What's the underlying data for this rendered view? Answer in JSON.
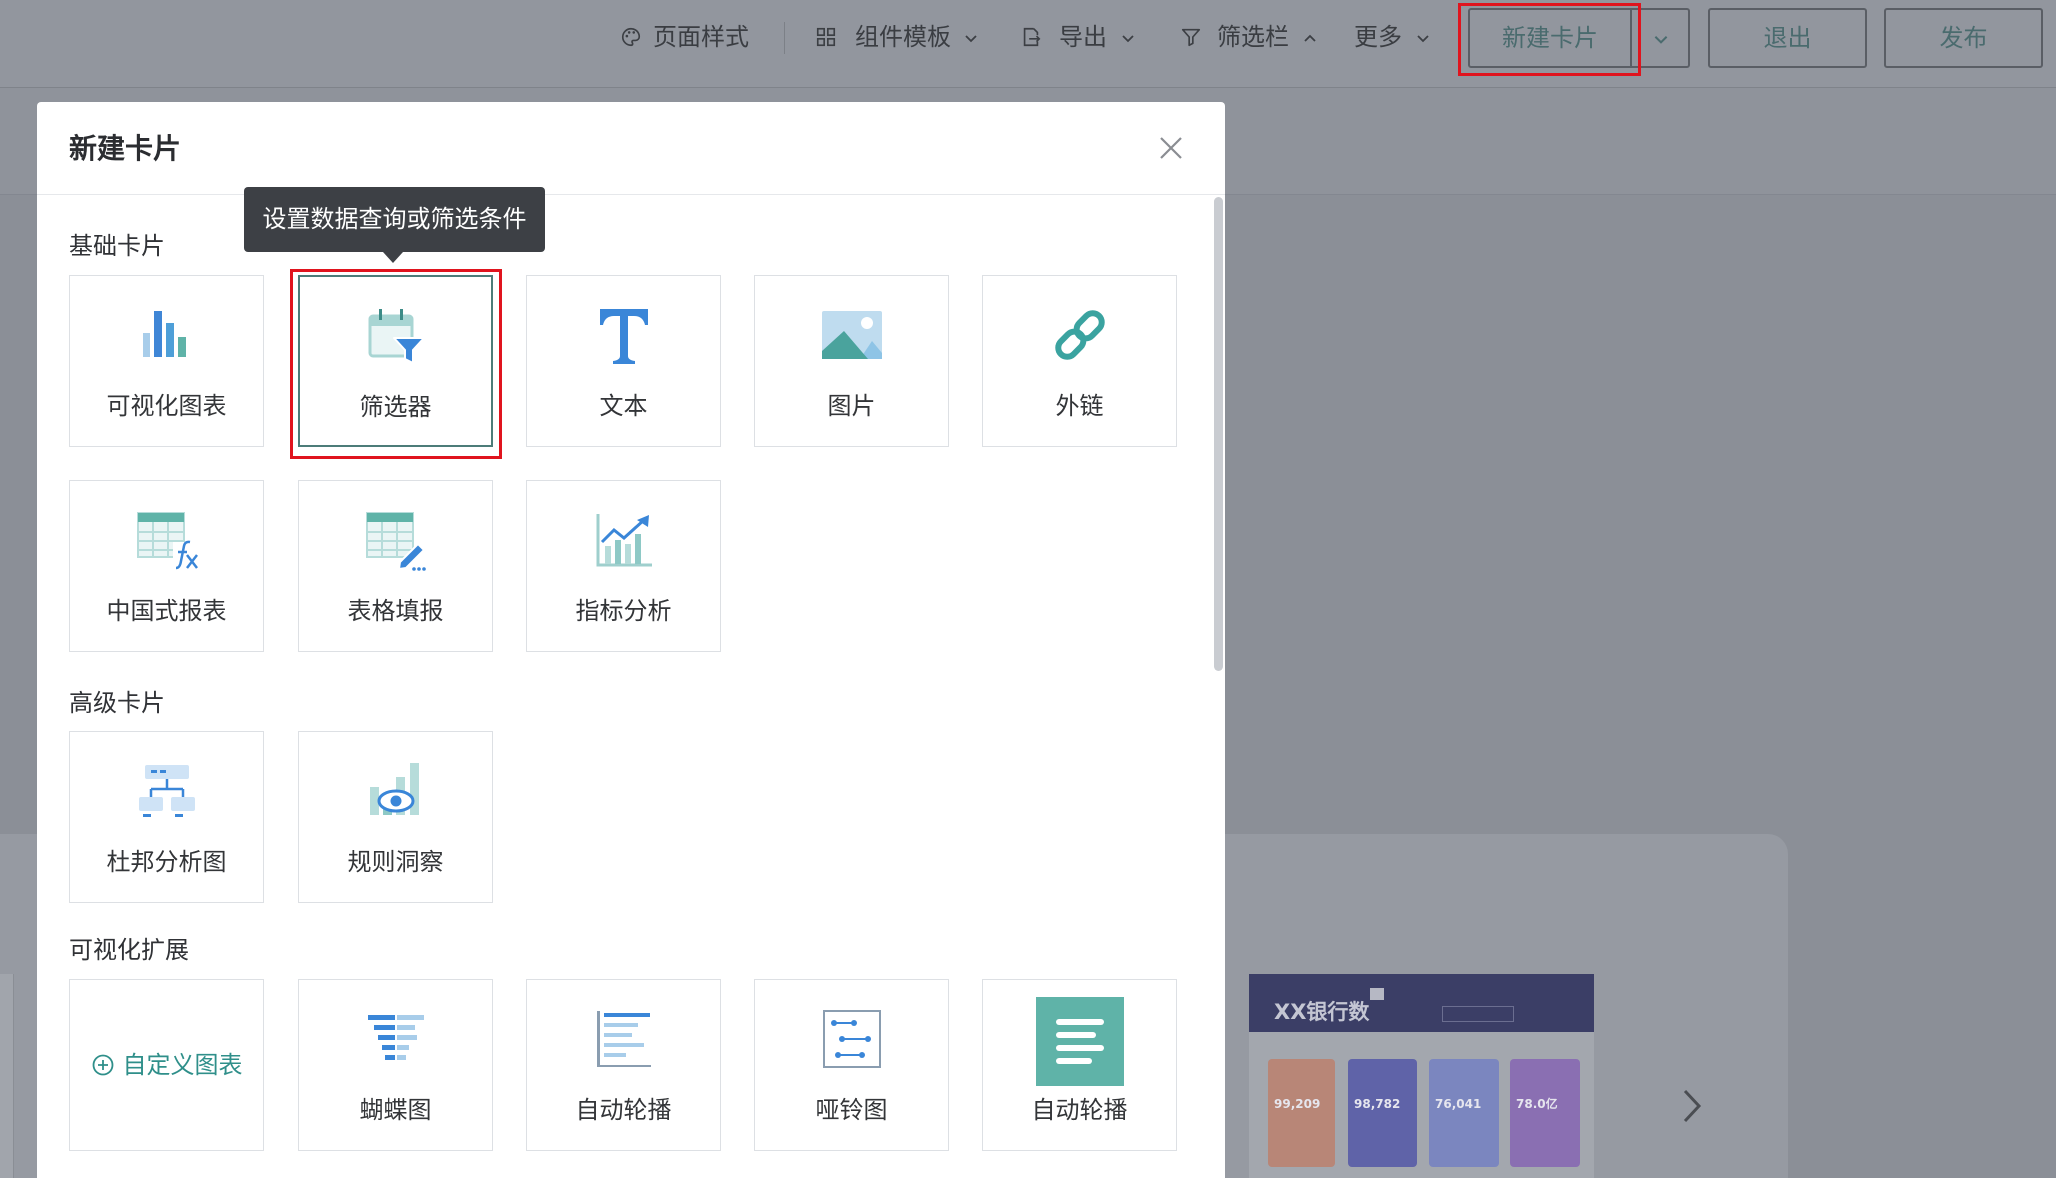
{
  "toolbar": {
    "page_style": "页面样式",
    "component_template": "组件模板",
    "export": "导出",
    "filter_bar": "筛选栏",
    "more": "更多",
    "new_card": "新建卡片",
    "exit": "退出",
    "publish": "发布"
  },
  "modal": {
    "title": "新建卡片",
    "tooltip": "设置数据查询或筛选条件",
    "sections": [
      {
        "title": "基础卡片",
        "cards": [
          {
            "label": "可视化图表",
            "icon": "bar-chart-icon"
          },
          {
            "label": "筛选器",
            "icon": "filter-calendar-icon",
            "selected": true
          },
          {
            "label": "文本",
            "icon": "text-t-icon"
          },
          {
            "label": "图片",
            "icon": "image-icon"
          },
          {
            "label": "外链",
            "icon": "link-icon"
          },
          {
            "label": "中国式报表",
            "icon": "formula-table-icon"
          },
          {
            "label": "表格填报",
            "icon": "table-edit-icon"
          },
          {
            "label": "指标分析",
            "icon": "metric-trend-icon"
          }
        ]
      },
      {
        "title": "高级卡片",
        "cards": [
          {
            "label": "杜邦分析图",
            "icon": "tree-diagram-icon"
          },
          {
            "label": "规则洞察",
            "icon": "chart-eye-icon"
          }
        ]
      },
      {
        "title": "可视化扩展",
        "cards": [
          {
            "label": "自定义图表",
            "icon": "plus-circle-icon"
          },
          {
            "label": "蝴蝶图",
            "icon": "butterfly-chart-icon"
          },
          {
            "label": "自动轮播",
            "icon": "list-bars-icon"
          },
          {
            "label": "哑铃图",
            "icon": "dumbbell-chart-icon"
          },
          {
            "label": "自动轮播",
            "icon": "carousel-lines-icon"
          }
        ]
      }
    ]
  },
  "background": {
    "dashboard_title": "XX银行数",
    "metrics": [
      "99,209",
      "98,782",
      "76,041",
      "78.0亿"
    ]
  },
  "colors": {
    "accent_teal": "#3aa3a0",
    "accent_blue": "#3a86d8",
    "highlight_red": "#e0141e",
    "tooltip_bg": "#3d4045"
  }
}
